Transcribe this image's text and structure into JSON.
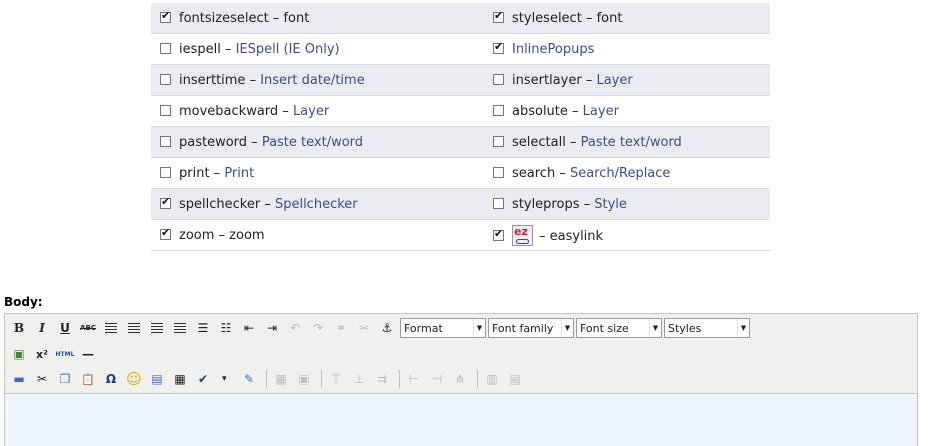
{
  "plugins": [
    {
      "left": {
        "checked": true,
        "name": "fontsizeselect",
        "desc": "font",
        "linked": false
      },
      "right": {
        "checked": true,
        "name": "styleselect",
        "desc": "font",
        "linked": false
      }
    },
    {
      "left": {
        "checked": false,
        "name": "iespell",
        "desc": "IESpell (IE Only)",
        "linked": true
      },
      "right": {
        "checked": true,
        "name": "",
        "desc": "InlinePopups",
        "linked": true
      }
    },
    {
      "left": {
        "checked": false,
        "name": "inserttime",
        "desc": "Insert date/time",
        "linked": true
      },
      "right": {
        "checked": false,
        "name": "insertlayer",
        "desc": "Layer",
        "linked": true
      }
    },
    {
      "left": {
        "checked": false,
        "name": "movebackward",
        "desc": "Layer",
        "linked": true
      },
      "right": {
        "checked": false,
        "name": "absolute",
        "desc": "Layer",
        "linked": true
      }
    },
    {
      "left": {
        "checked": false,
        "name": "pasteword",
        "desc": "Paste text/word",
        "linked": true
      },
      "right": {
        "checked": false,
        "name": "selectall",
        "desc": "Paste text/word",
        "linked": true
      }
    },
    {
      "left": {
        "checked": false,
        "name": "print",
        "desc": "Print",
        "linked": true
      },
      "right": {
        "checked": false,
        "name": "search",
        "desc": "Search/Replace",
        "linked": true
      }
    },
    {
      "left": {
        "checked": true,
        "name": "spellchecker",
        "desc": "Spellchecker",
        "linked": true
      },
      "right": {
        "checked": false,
        "name": "styleprops",
        "desc": "Style",
        "linked": true
      }
    },
    {
      "left": {
        "checked": true,
        "name": "zoom",
        "desc": "zoom",
        "linked": false
      },
      "right": {
        "checked": true,
        "name": "",
        "desc": "easylink",
        "linked": false,
        "logo": "ez-logo",
        "logo_text": "ez"
      }
    }
  ],
  "body_label": "Body:",
  "toolbar": {
    "row1_buttons": [
      {
        "icon": "bold-icon",
        "glyph": "B",
        "style": "font-weight:bold;font-family:'DejaVu Serif',serif"
      },
      {
        "icon": "italic-icon",
        "glyph": "I",
        "style": "font-style:italic;font-weight:bold;font-family:'DejaVu Serif',serif"
      },
      {
        "icon": "underline-icon",
        "glyph": "U",
        "style": "text-decoration:underline;font-weight:bold"
      },
      {
        "icon": "strikethrough-icon",
        "glyph": "ABC",
        "style": "text-decoration:line-through;font-size:7px;font-weight:bold"
      }
    ],
    "row1_align": [
      "align-left-icon",
      "align-center-icon",
      "align-right-icon",
      "align-justify-icon"
    ],
    "row1_lists": [
      {
        "icon": "bullet-list-icon",
        "glyph": "☰"
      },
      {
        "icon": "numbered-list-icon",
        "glyph": "☷"
      },
      {
        "icon": "outdent-icon",
        "glyph": "⇤"
      },
      {
        "icon": "indent-icon",
        "glyph": "⇥"
      },
      {
        "icon": "undo-icon",
        "glyph": "↶",
        "disabled": true
      },
      {
        "icon": "redo-icon",
        "glyph": "↷",
        "disabled": true
      },
      {
        "icon": "link-icon",
        "glyph": "⚭",
        "disabled": true
      },
      {
        "icon": "unlink-icon",
        "glyph": "✂",
        "disabled": true
      },
      {
        "icon": "anchor-icon",
        "glyph": "⚓"
      }
    ],
    "selects": [
      {
        "name": "format-select",
        "label": "Format",
        "width": 86
      },
      {
        "name": "font-family-select",
        "label": "Font family",
        "width": 86
      },
      {
        "name": "font-size-select",
        "label": "Font size",
        "width": 86
      },
      {
        "name": "styles-select",
        "label": "Styles",
        "width": 86
      }
    ],
    "row2_buttons": [
      {
        "icon": "insert-image-icon",
        "glyph": "▣",
        "style": "color:#3a8a2a"
      },
      {
        "icon": "superscript-icon",
        "glyph": "x²",
        "style": "font-weight:bold;font-size:11px"
      },
      {
        "icon": "html-source-icon",
        "glyph": "HTML",
        "style": "font-size:6px;color:#2d4f9a;font-weight:bold"
      },
      {
        "icon": "horizontal-rule-icon",
        "glyph": "—",
        "style": "font-weight:bold"
      }
    ],
    "row3_buttons": [
      {
        "icon": "insert-line-icon",
        "glyph": "▬",
        "style": "color:#3a6fc9"
      },
      {
        "icon": "cut-icon",
        "glyph": "✂",
        "style": ""
      },
      {
        "icon": "copy-icon",
        "glyph": "❐",
        "style": "color:#3a6fc9"
      },
      {
        "icon": "paste-icon",
        "glyph": "📋",
        "style": "font-size:11px"
      },
      {
        "icon": "special-char-icon",
        "glyph": "Ω",
        "style": "font-weight:bold;color:#1a3f8a"
      },
      {
        "icon": "emoticon-icon",
        "glyph": "☺",
        "style": "color:#d9a800;font-size:15px"
      },
      {
        "icon": "media-icon",
        "glyph": "▤",
        "style": "color:#3a6fc9"
      },
      {
        "icon": "paste-word-icon",
        "glyph": "▦",
        "style": ""
      },
      {
        "icon": "spellcheck-icon",
        "glyph": "✔",
        "style": "color:#1a3f8a"
      },
      {
        "icon": "dropdown-arrow-icon",
        "glyph": "▾",
        "style": "width:8px;font-size:9px"
      },
      {
        "icon": "edit-icon",
        "glyph": "✎",
        "style": "color:#3a6fc9"
      }
    ],
    "row3_disabled": [
      {
        "icon": "table-icon",
        "glyph": "▦"
      },
      {
        "icon": "table-props-icon",
        "glyph": "▣"
      },
      {
        "icon": "row-before-icon",
        "glyph": "⊤"
      },
      {
        "icon": "row-after-icon",
        "glyph": "⊥"
      },
      {
        "icon": "delete-row-icon",
        "glyph": "⇉"
      },
      {
        "icon": "col-before-icon",
        "glyph": "⊢"
      },
      {
        "icon": "col-after-icon",
        "glyph": "⊣"
      },
      {
        "icon": "delete-col-icon",
        "glyph": "⋔"
      },
      {
        "icon": "split-cells-icon",
        "glyph": "▥"
      },
      {
        "icon": "merge-cells-icon",
        "glyph": "▤"
      }
    ]
  }
}
